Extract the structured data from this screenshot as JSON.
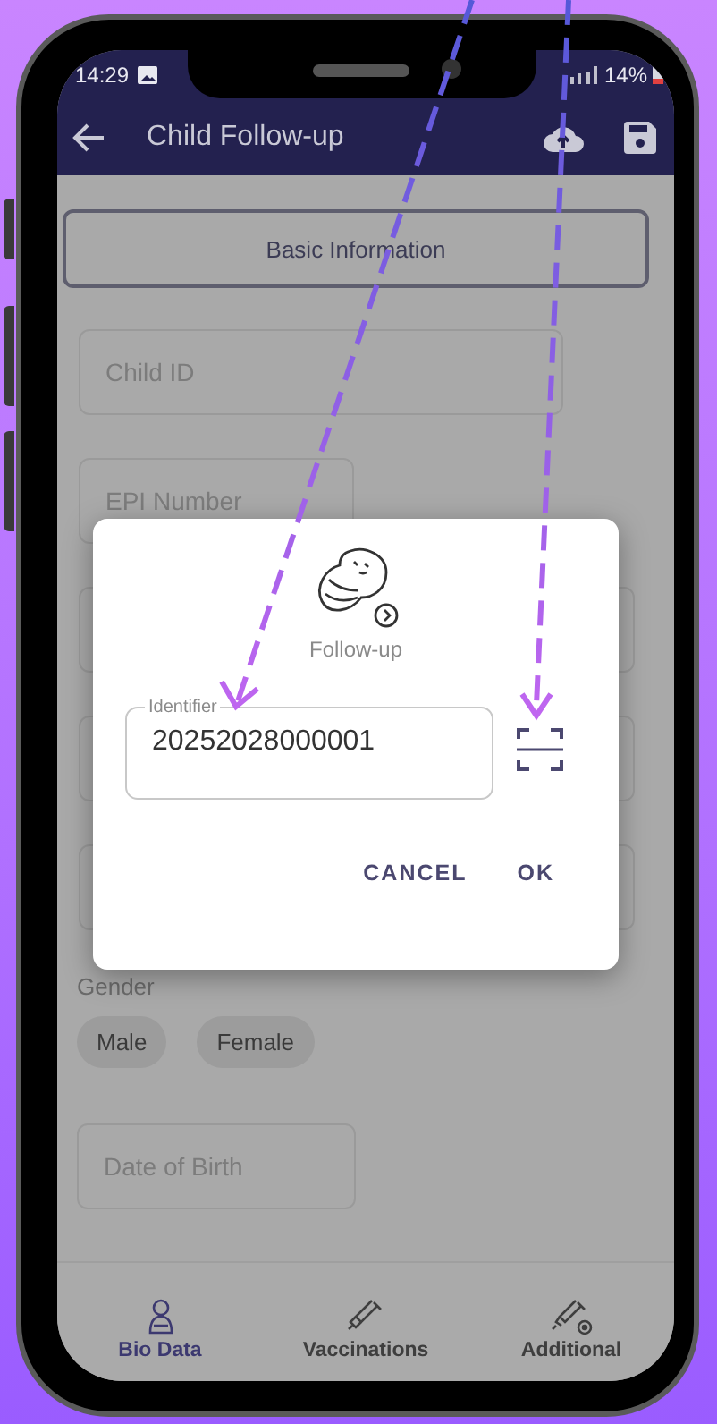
{
  "status_bar": {
    "time": "14:29",
    "battery": "14%"
  },
  "app_bar": {
    "title": "Child Follow-up"
  },
  "section_button": "Basic Information",
  "fields": [
    {
      "placeholder": "Child ID",
      "kind": "wide"
    },
    {
      "placeholder": "EPI Number",
      "kind": "narrow"
    },
    {
      "kind": "full"
    },
    {
      "kind": "full"
    },
    {
      "kind": "full"
    }
  ],
  "gender": {
    "label": "Gender",
    "options": [
      {
        "label": "Male",
        "selected": false
      },
      {
        "label": "Female",
        "selected": false
      }
    ]
  },
  "date_of_birth": {
    "placeholder": "Date of Birth"
  },
  "bottom_nav": [
    {
      "label": "Bio Data",
      "kind": "baby",
      "selected": true
    },
    {
      "label": "Vaccinations",
      "kind": "syringe",
      "selected": false
    },
    {
      "label": "Additional",
      "kind": "syringe-plus",
      "selected": false
    }
  ],
  "dialog": {
    "title": "Follow-up",
    "field_label": "Identifier",
    "value": "20252028000001",
    "buttons": [
      "CANCEL",
      "OK"
    ]
  }
}
